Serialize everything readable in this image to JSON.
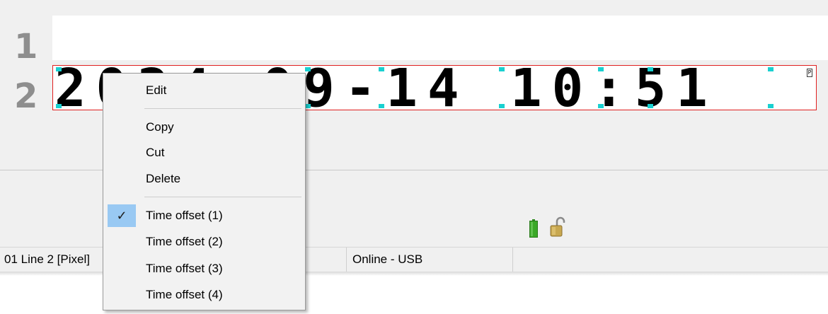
{
  "editor": {
    "line_numbers": [
      "1",
      "2"
    ],
    "line2_text": "2024-09-14 10:51",
    "corner_marker": "P"
  },
  "status_bar": {
    "segments": [
      "01 Line 2 [Pixel]",
      "Online - USB"
    ]
  },
  "icons": {
    "battery": "battery-icon",
    "lock": "unlocked-padlock-icon",
    "check": "checkmark-icon"
  },
  "context_menu": {
    "items": [
      {
        "label": "Edit"
      },
      {
        "label": "Copy"
      },
      {
        "label": "Cut"
      },
      {
        "label": "Delete"
      },
      {
        "label": "Time offset (1)",
        "checked": true
      },
      {
        "label": "Time offset (2)"
      },
      {
        "label": "Time offset (3)"
      },
      {
        "label": "Time offset (4)"
      }
    ]
  },
  "colors": {
    "selection_border": "#e02020",
    "check_highlight": "#99c9f3",
    "battery": "#3aa827",
    "lock": "#c8a850"
  }
}
